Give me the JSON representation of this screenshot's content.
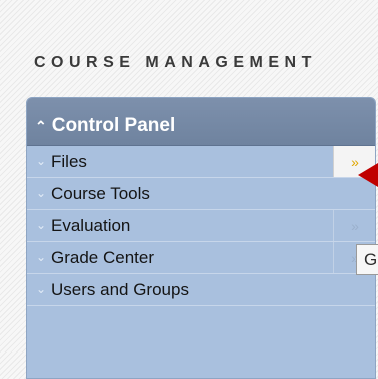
{
  "section_title": "COURSE MANAGEMENT",
  "control_panel": {
    "title": "Control Panel",
    "items": [
      {
        "label": "Files",
        "action_glyph": "»"
      },
      {
        "label": "Course Tools"
      },
      {
        "label": "Evaluation",
        "action_glyph": "»"
      },
      {
        "label": "Grade Center",
        "action_glyph": "»"
      },
      {
        "label": "Users and Groups"
      }
    ]
  },
  "tooltip": {
    "text": "G"
  },
  "colors": {
    "header_bg": "#7389a6",
    "menu_bg": "#a9c0de",
    "active_action": "#e1a700",
    "annotation_arrow": "#c00000"
  },
  "icons": {
    "expand": "chevron-double-down-icon",
    "collapse": "chevron-double-up-icon",
    "action": "double-chevron-right-icon"
  }
}
